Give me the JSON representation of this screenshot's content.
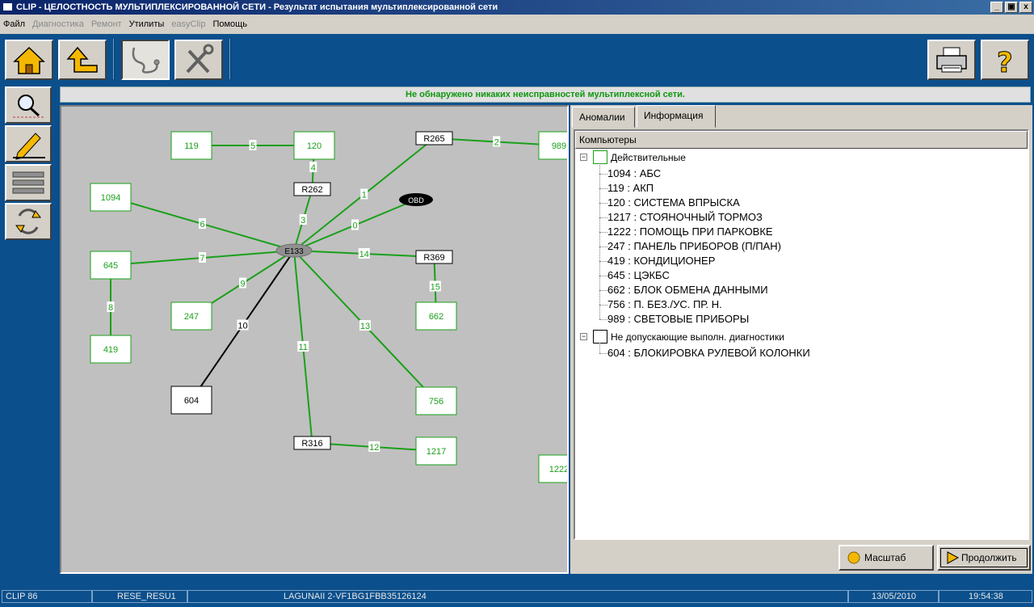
{
  "window": {
    "title": "CLIP - ЦЕЛОСТНОСТЬ МУЛЬТИПЛЕКСИРОВАННОЙ СЕТИ - Результат испытания мультиплексированной сети",
    "buttons": [
      "_",
      "▣",
      "x"
    ]
  },
  "menu": [
    {
      "label": "Файл",
      "enabled": true
    },
    {
      "label": "Диагностика",
      "enabled": false
    },
    {
      "label": "Ремонт",
      "enabled": false
    },
    {
      "label": "Утилиты",
      "enabled": true
    },
    {
      "label": "easyClip",
      "enabled": false
    },
    {
      "label": "Помощь",
      "enabled": true
    }
  ],
  "toolbar": {
    "left": [
      "home-icon",
      "back-icon",
      "stethoscope-icon",
      "tools-icon"
    ],
    "right": [
      "printer-icon",
      "help-icon"
    ]
  },
  "side_buttons": [
    "search-network-icon",
    "edit-network-icon",
    "network-list-icon",
    "cycle-icon"
  ],
  "status_message": "Не обнаружено никаких неисправностей мультиплексной сети.",
  "colors": {
    "ok_green": "#109810",
    "line_green": "#1aa01a",
    "background_blue": "#0b4f8c"
  },
  "network": {
    "hub": "E133",
    "obd": "OBD",
    "nodes": {
      "119": {
        "label": "119",
        "status": "ok"
      },
      "120": {
        "label": "120",
        "status": "ok"
      },
      "989": {
        "label": "989",
        "status": "ok"
      },
      "1094": {
        "label": "1094",
        "status": "ok"
      },
      "645": {
        "label": "645",
        "status": "ok"
      },
      "419": {
        "label": "419",
        "status": "ok"
      },
      "247": {
        "label": "247",
        "status": "ok"
      },
      "604": {
        "label": "604",
        "status": "nodiag"
      },
      "662": {
        "label": "662",
        "status": "ok"
      },
      "756": {
        "label": "756",
        "status": "ok"
      },
      "1217": {
        "label": "1217",
        "status": "ok"
      },
      "1222": {
        "label": "1222",
        "status": "ok"
      },
      "R265": {
        "label": "R265",
        "status": "junction"
      },
      "R262": {
        "label": "R262",
        "status": "junction"
      },
      "R369": {
        "label": "R369",
        "status": "junction"
      },
      "R316": {
        "label": "R316",
        "status": "junction"
      }
    },
    "links": [
      {
        "from": "119",
        "to": "120",
        "label": "5"
      },
      {
        "from": "120",
        "to": "R262",
        "label": "4"
      },
      {
        "from": "R262",
        "to": "E133",
        "label": "3"
      },
      {
        "from": "R265",
        "to": "989",
        "label": "2"
      },
      {
        "from": "R265",
        "to": "E133",
        "label": "1"
      },
      {
        "from": "OBD",
        "to": "E133",
        "label": "0"
      },
      {
        "from": "1094",
        "to": "E133",
        "label": "6"
      },
      {
        "from": "645",
        "to": "E133",
        "label": "7"
      },
      {
        "from": "645",
        "to": "419",
        "label": "8"
      },
      {
        "from": "247",
        "to": "E133",
        "label": "9"
      },
      {
        "from": "604",
        "to": "E133",
        "label": "10",
        "status": "nodiag"
      },
      {
        "from": "E133",
        "to": "R316",
        "label": "11"
      },
      {
        "from": "R316",
        "to": "1217",
        "label": "12"
      },
      {
        "from": "E133",
        "to": "756",
        "label": "13"
      },
      {
        "from": "E133",
        "to": "R369",
        "label": "14"
      },
      {
        "from": "R369",
        "to": "662",
        "label": "15"
      }
    ]
  },
  "tabs": [
    {
      "label": "Аномалии",
      "active": false
    },
    {
      "label": "Информация",
      "active": true
    }
  ],
  "tree": {
    "header": "Компьютеры",
    "groups": [
      {
        "label": "Действительные",
        "status": "ok",
        "items": [
          "1094 : АБС",
          "119 : АКП",
          "120 : СИСТЕМА ВПРЫСКА",
          "1217 : СТОЯНОЧНЫЙ ТОРМОЗ",
          "1222 : ПОМОЩЬ ПРИ ПАРКОВКЕ",
          "247 : ПАНЕЛЬ ПРИБОРОВ (П/ПАН)",
          "419 : КОНДИЦИОНЕР",
          "645 : ЦЭКБС",
          "662 : БЛОК ОБМЕНА ДАННЫМИ",
          "756 : П. БЕЗ./УС. ПР. Н.",
          "989 : СВЕТОВЫЕ ПРИБОРЫ"
        ]
      },
      {
        "label": "Не допускающие выполн. диагностики",
        "status": "nodiag",
        "items": [
          "604 : БЛОКИРОВКА РУЛЕВОЙ КОЛОНКИ"
        ]
      }
    ]
  },
  "bottom_buttons": {
    "zoom": "Масштаб",
    "continue": "Продолжить"
  },
  "statusbar": [
    "CLIP 86",
    "RESE_RESU1",
    "LAGUNAII 2-VF1BG1FBB35126124",
    "",
    "13/05/2010",
    "19:54:38"
  ]
}
